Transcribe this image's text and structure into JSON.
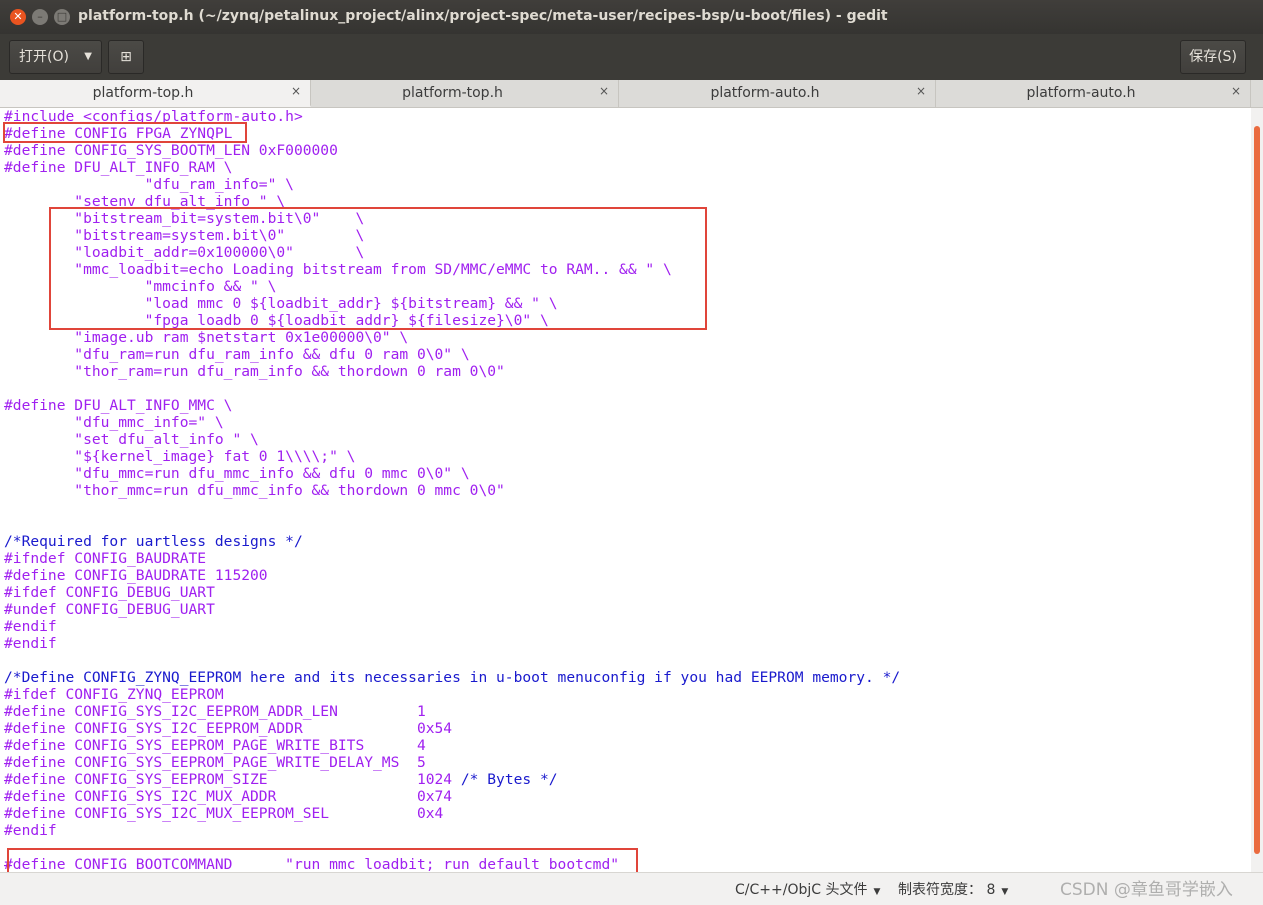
{
  "window": {
    "title": "platform-top.h (~/zynq/petalinux_project/alinx/project-spec/meta-user/recipes-bsp/u-boot/files) - gedit",
    "close_glyph": "✕",
    "min_glyph": "–",
    "max_glyph": "□"
  },
  "toolbar": {
    "open_label": "打开(O)",
    "open_arrow": "▼",
    "new_glyph": "⊞",
    "save_label": "保存(S)"
  },
  "tabs": [
    {
      "label": "platform-top.h",
      "close": "×",
      "active": true
    },
    {
      "label": "platform-top.h",
      "close": "×",
      "active": false
    },
    {
      "label": "platform-auto.h",
      "close": "×",
      "active": false
    },
    {
      "label": "platform-auto.h",
      "close": "×",
      "active": false
    }
  ],
  "code": [
    "#include <configs/platform-auto.h>",
    "#define CONFIG_FPGA_ZYNQPL",
    "#define CONFIG_SYS_BOOTM_LEN 0xF000000",
    "#define DFU_ALT_INFO_RAM \\",
    "                \"dfu_ram_info=\" \\",
    "        \"setenv dfu_alt_info \" \\",
    "        \"bitstream_bit=system.bit\\0\"    \\",
    "        \"bitstream=system.bit\\0\"        \\",
    "        \"loadbit_addr=0x100000\\0\"       \\",
    "        \"mmc_loadbit=echo Loading bitstream from SD/MMC/eMMC to RAM.. && \" \\",
    "                \"mmcinfo && \" \\",
    "                \"load mmc 0 ${loadbit_addr} ${bitstream} && \" \\",
    "                \"fpga loadb 0 ${loadbit_addr} ${filesize}\\0\" \\",
    "        \"image.ub ram $netstart 0x1e00000\\0\" \\",
    "        \"dfu_ram=run dfu_ram_info && dfu 0 ram 0\\0\" \\",
    "        \"thor_ram=run dfu_ram_info && thordown 0 ram 0\\0\"",
    "",
    "#define DFU_ALT_INFO_MMC \\",
    "        \"dfu_mmc_info=\" \\",
    "        \"set dfu_alt_info \" \\",
    "        \"${kernel_image} fat 0 1\\\\\\\\;\" \\",
    "        \"dfu_mmc=run dfu_mmc_info && dfu 0 mmc 0\\0\" \\",
    "        \"thor_mmc=run dfu_mmc_info && thordown 0 mmc 0\\0\"",
    "",
    "",
    "/*Required for uartless designs */",
    "#ifndef CONFIG_BAUDRATE",
    "#define CONFIG_BAUDRATE 115200",
    "#ifdef CONFIG_DEBUG_UART",
    "#undef CONFIG_DEBUG_UART",
    "#endif",
    "#endif",
    "",
    "/*Define CONFIG_ZYNQ_EEPROM here and its necessaries in u-boot menuconfig if you had EEPROM memory. */",
    "#ifdef CONFIG_ZYNQ_EEPROM",
    "#define CONFIG_SYS_I2C_EEPROM_ADDR_LEN         1",
    "#define CONFIG_SYS_I2C_EEPROM_ADDR             0x54",
    "#define CONFIG_SYS_EEPROM_PAGE_WRITE_BITS      4",
    "#define CONFIG_SYS_EEPROM_PAGE_WRITE_DELAY_MS  5",
    "#define CONFIG_SYS_EEPROM_SIZE                 1024 /* Bytes */",
    "#define CONFIG_SYS_I2C_MUX_ADDR                0x74",
    "#define CONFIG_SYS_I2C_MUX_EEPROM_SEL          0x4",
    "#endif",
    "",
    "#define CONFIG_BOOTCOMMAND      \"run mmc_loadbit; run default_bootcmd\""
  ],
  "status": {
    "language": "C/C++/ObjC 头文件",
    "tab_width": "制表符宽度： 8",
    "arrow": "▼",
    "watermark": "CSDN @章鱼哥学嵌入"
  },
  "colors": {
    "code_text": "#a020f0",
    "comment": "#1a1acd",
    "highlight_box": "#e0453a",
    "title_bar": "#3c3b37"
  }
}
